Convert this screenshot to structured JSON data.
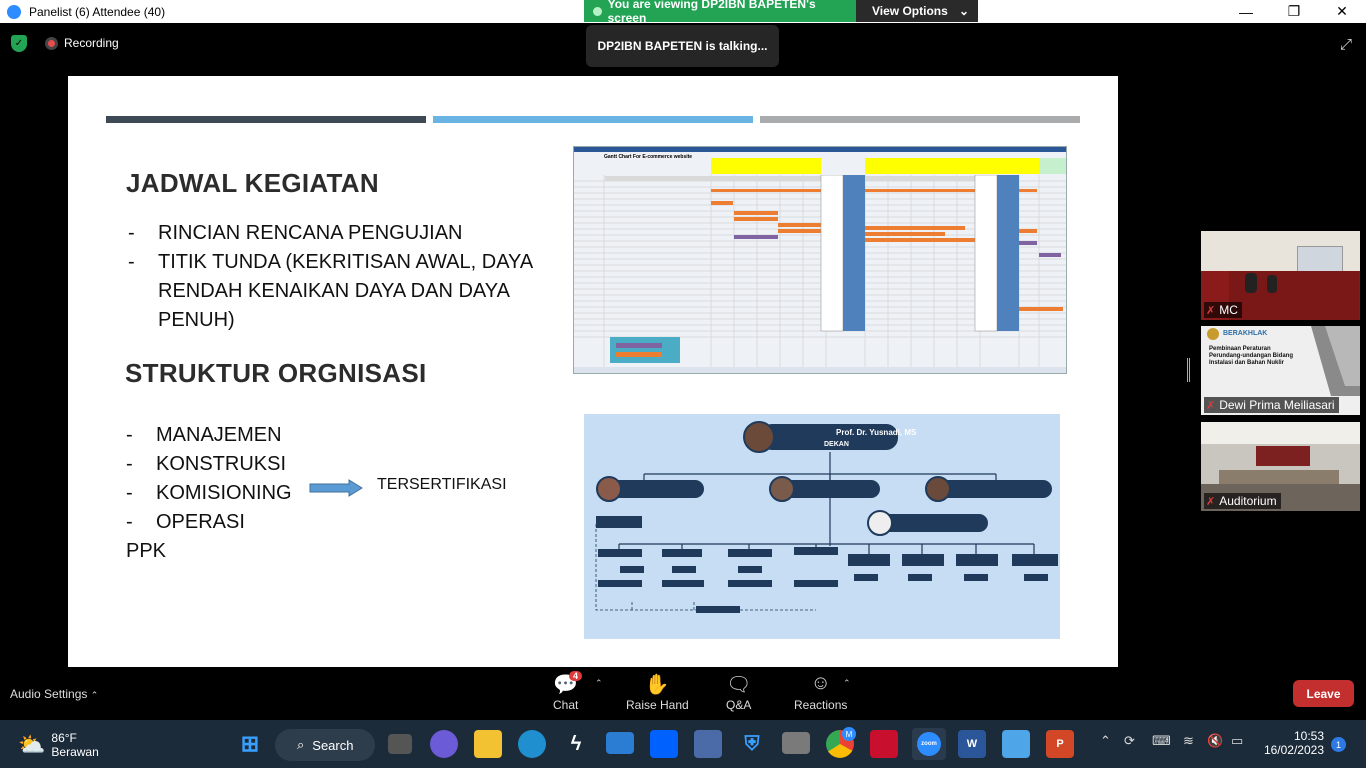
{
  "titlebar": {
    "title": "Panelist (6) Attendee (40)",
    "minimize": "—",
    "maximize": "❐",
    "close": "✕"
  },
  "banner": {
    "viewing": "You are viewing DP2IBN BAPETEN's screen",
    "view_options": "View Options",
    "chevron": "⌄"
  },
  "talking": "DP2IBN BAPETEN is talking...",
  "recording": "Recording",
  "slide": {
    "heading1": "JADWAL KEGIATAN",
    "bullets1": [
      {
        "dash": "-",
        "text": "RINCIAN RENCANA PENGUJIAN"
      },
      {
        "dash": "-",
        "text": "TITIK TUNDA (KEKRITISAN AWAL, DAYA"
      },
      {
        "dash": "",
        "text": "RENDAH KENAIKAN DAYA DAN DAYA"
      },
      {
        "dash": "",
        "text": "PENUH)"
      }
    ],
    "heading2": "STRUKTUR ORGNISASI",
    "bullets2": [
      {
        "dash": "-",
        "text": "MANAJEMEN"
      },
      {
        "dash": "-",
        "text": "KONSTRUKSI"
      },
      {
        "dash": "-",
        "text": "KOMISIONING"
      },
      {
        "dash": "-",
        "text": "OPERASI"
      }
    ],
    "ppk": "PPK",
    "certified": "TERSERTIFIKASI",
    "org_top_name": "Prof. Dr. Yusnadi, MS",
    "org_top_title": "DEKAN",
    "gantt_title": "Gantt Chart For E-commerce website",
    "colors": {
      "bar1": "#3d4a56",
      "bar2": "#6ab4e4",
      "bar3": "#a9abad"
    }
  },
  "participants": [
    {
      "name": "MC"
    },
    {
      "name": "Dewi Prima Meiliasari",
      "slide_brand": "BERAKHLAK",
      "slide_text": "Pembinaan Peraturan Perundang-undangan Bidang Instalasi dan Bahan Nuklir"
    },
    {
      "name": "Auditorium"
    }
  ],
  "toolbar": {
    "audio_settings": "Audio Settings",
    "chat": "Chat",
    "chat_badge": "4",
    "raise_hand": "Raise Hand",
    "qa": "Q&A",
    "reactions": "Reactions",
    "leave": "Leave"
  },
  "taskbar": {
    "temp": "86°F",
    "weather": "Berawan",
    "search": "Search",
    "time": "10:53",
    "date": "16/02/2023",
    "notifications": "1",
    "chrome_badge": "M"
  }
}
